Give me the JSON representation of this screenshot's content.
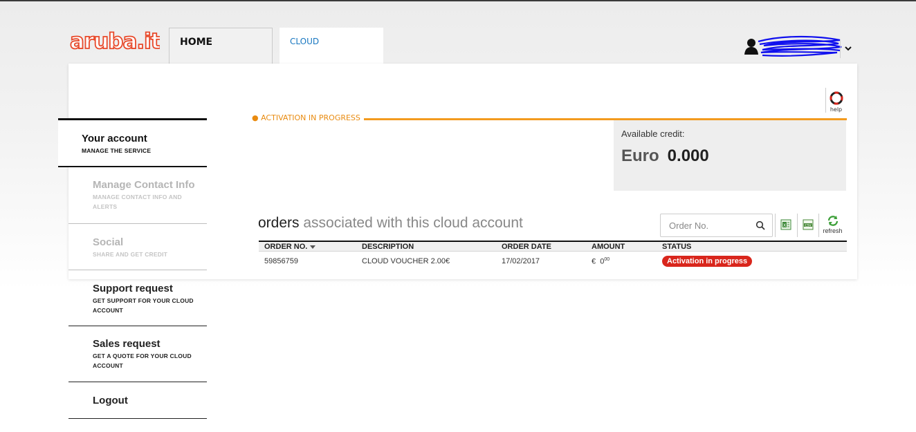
{
  "brand": {
    "logo_text": "aruba.it",
    "logo_color": "#e8492a"
  },
  "header": {
    "tabs": [
      {
        "label": "HOME",
        "active": false
      },
      {
        "label": "CLOUD",
        "active": true
      }
    ],
    "user": {
      "icon": "user-icon",
      "menu_icon": "chevron-down-icon"
    }
  },
  "help": {
    "label": "help",
    "icon": "lifebuoy-icon"
  },
  "status": {
    "caption": "● ACTIVATION IN PROGRESS",
    "color": "#f39a1e"
  },
  "credit": {
    "label": "Available credit:",
    "currency": "Euro",
    "amount": "0.000"
  },
  "sidebar": {
    "items": [
      {
        "title": "Your account",
        "subtitle": "MANAGE THE SERVICE",
        "state": "active"
      },
      {
        "title": "Manage Contact Info",
        "subtitle": "MANAGE CONTACT INFO AND ALERTS",
        "state": "disabled"
      },
      {
        "title": "Social",
        "subtitle": "SHARE AND GET CREDIT",
        "state": "disabled"
      },
      {
        "title": "Support request",
        "subtitle": "GET SUPPORT FOR YOUR CLOUD ACCOUNT",
        "state": "normal"
      },
      {
        "title": "Sales request",
        "subtitle": "GET A QUOTE FOR YOUR CLOUD ACCOUNT",
        "state": "normal"
      },
      {
        "title": "Logout",
        "subtitle": "",
        "state": "normal"
      }
    ]
  },
  "orders": {
    "title_strong": "orders",
    "title_rest": " associated with this cloud account",
    "search": {
      "placeholder": "Order No.",
      "value": ""
    },
    "tools": {
      "excel_icon": "excel-export-icon",
      "csv_icon": "csv-export-icon",
      "refresh_label": "refresh"
    },
    "columns": [
      "ORDER NO.",
      "DESCRIPTION",
      "ORDER DATE",
      "AMOUNT",
      "STATUS"
    ],
    "rows": [
      {
        "order_no": "59856759",
        "description": "CLOUD VOUCHER 2.00€",
        "date": "17/02/2017",
        "amount_currency": "€",
        "amount_int": "0",
        "amount_dec": "00",
        "status": "Activation in progress"
      }
    ],
    "status_badge_color": "#d9261c"
  }
}
